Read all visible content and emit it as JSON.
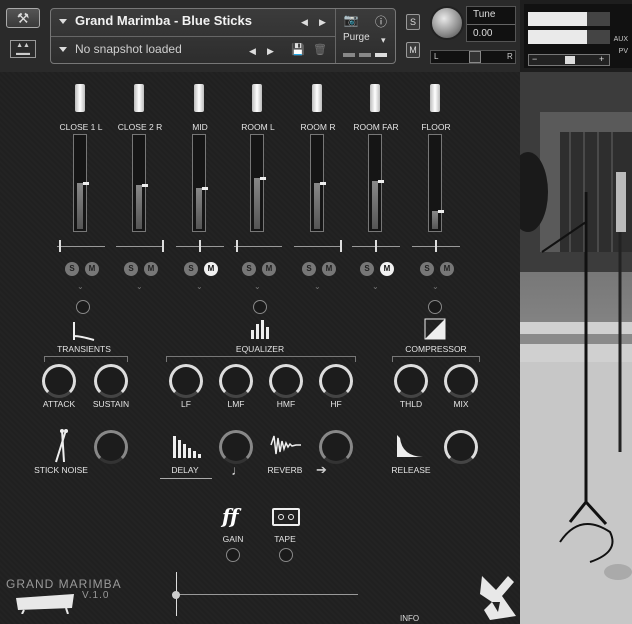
{
  "header": {
    "instrument_name": "Grand Marimba - Blue Sticks",
    "snapshot": "No snapshot loaded",
    "purge_label": "Purge",
    "solo_label": "S",
    "mute_label": "M",
    "tune_label": "Tune",
    "tune_value": "0.00",
    "pan_left": "L",
    "pan_right": "R",
    "aux_label": "AUX",
    "pv_label": "PV",
    "vol_minus": "−",
    "vol_plus": "+",
    "meter_levels": [
      0.72,
      0.72
    ]
  },
  "channels": [
    {
      "label": "CLOSE 1 L",
      "level": 0.5,
      "solo": "S",
      "mute": "M",
      "mute_on": false
    },
    {
      "label": "CLOSE 2 R",
      "level": 0.48,
      "solo": "S",
      "mute": "M",
      "mute_on": false
    },
    {
      "label": "MID",
      "level": 0.45,
      "solo": "S",
      "mute": "M",
      "mute_on": true
    },
    {
      "label": "ROOM L",
      "level": 0.55,
      "solo": "S",
      "mute": "M",
      "mute_on": false
    },
    {
      "label": "ROOM R",
      "level": 0.5,
      "solo": "S",
      "mute": "M",
      "mute_on": false
    },
    {
      "label": "ROOM FAR",
      "level": 0.52,
      "solo": "S",
      "mute": "M",
      "mute_on": true
    },
    {
      "label": "FLOOR",
      "level": 0.2,
      "solo": "S",
      "mute": "M",
      "mute_on": false
    }
  ],
  "sections": {
    "transients": "TRANSIENTS",
    "equalizer": "EQUALIZER",
    "compressor": "COMPRESSOR"
  },
  "knobs": {
    "attack": "ATTACK",
    "sustain": "SUSTAIN",
    "lf": "LF",
    "lmf": "LMF",
    "hmf": "HMF",
    "hf": "HF",
    "thld": "THLD",
    "mix": "MIX",
    "stick_noise": "STICK NOISE",
    "delay": "DELAY",
    "reverb": "REVERB",
    "release": "RELEASE",
    "gain": "GAIN",
    "tape": "TAPE"
  },
  "footer": {
    "logo_line1": "GRAND MARIMBA",
    "version": "V.1.0",
    "info": "INFO"
  },
  "glyphs": {
    "note": "♩",
    "arrow": "➔",
    "ff": "ff"
  }
}
